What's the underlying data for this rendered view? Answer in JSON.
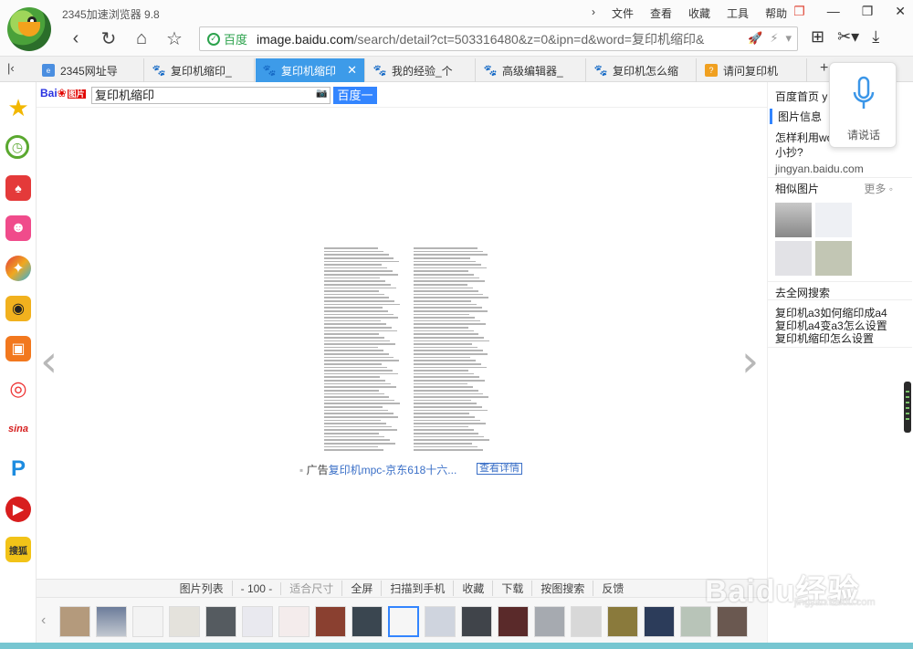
{
  "app": {
    "title": "2345加速浏览器 9.8"
  },
  "menu": [
    "文件",
    "查看",
    "收藏",
    "工具",
    "帮助"
  ],
  "address": {
    "site_label": "百度",
    "url_prefix": "image.baidu.com",
    "url_rest": "/search/detail?ct=503316480&z=0&ipn=d&word=复印机缩印&"
  },
  "tabs": [
    {
      "label": "2345网址导",
      "active": false,
      "icon": "2345-icon"
    },
    {
      "label": "复印机缩印_",
      "active": false,
      "icon": "baidu-paw-icon"
    },
    {
      "label": "复印机缩印",
      "active": true,
      "icon": "baidu-paw-icon"
    },
    {
      "label": "我的经验_个",
      "active": false,
      "icon": "baidu-paw-icon"
    },
    {
      "label": "高级编辑器_",
      "active": false,
      "icon": "baidu-paw-icon"
    },
    {
      "label": "复印机怎么缩",
      "active": false,
      "icon": "baidu-paw-icon"
    },
    {
      "label": "请问复印机",
      "active": false,
      "icon": "zhidao-icon"
    }
  ],
  "baidu": {
    "logo": {
      "bai": "Bai",
      "du_icon": "du",
      "pic": "图片"
    },
    "search_value": "复印机缩印",
    "search_button": "百度一下"
  },
  "viewer": {
    "ad_label": "广告",
    "ad_text": "复印机mpc-京东618十六...",
    "ad_button": "查看详情"
  },
  "toolbar": [
    "图片列表",
    "- 100 -",
    "适合尺寸",
    "全屏",
    "扫描到手机",
    "收藏",
    "下载",
    "按图搜索",
    "反馈"
  ],
  "right_panel": {
    "home": "百度首页",
    "home_suffix": "y",
    "info_title": "图片信息",
    "info_text": "怎样利用wo行缩印打小抄?",
    "info_source": "jingyan.baidu.com",
    "similar_title": "相似图片",
    "similar_more": "更多",
    "web_search_title": "去全网搜索",
    "links": [
      "复印机a3如何缩印成a4",
      "复印机a4变a3怎么设置",
      "复印机缩印怎么设置"
    ]
  },
  "voice": {
    "label": "请说话"
  },
  "watermark": {
    "text": "Baidu经验",
    "url": "jingyan.baidu.com"
  },
  "colors": {
    "accent": "#3d9be9",
    "baidu_blue": "#3385ff",
    "secure_green": "#2ba24c"
  }
}
